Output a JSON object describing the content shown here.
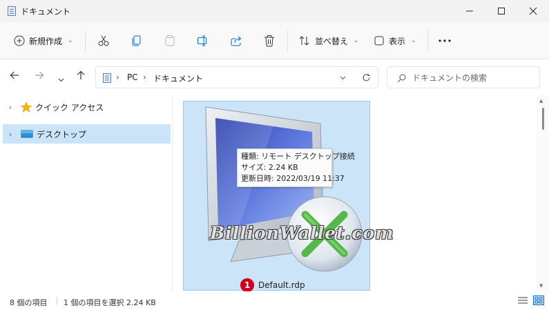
{
  "window": {
    "title": "ドキュメント",
    "minimize_icon": "minimize-icon",
    "maximize_icon": "maximize-icon",
    "close_icon": "close-icon"
  },
  "toolbar": {
    "new_label": "新規作成",
    "sort_label": "並べ替え",
    "view_label": "表示",
    "icons": [
      "cut-icon",
      "copy-icon",
      "paste-icon",
      "rename-icon",
      "share-icon",
      "delete-icon",
      "more-icon"
    ]
  },
  "address": {
    "breadcrumb": [
      "PC",
      "ドキュメント"
    ]
  },
  "search": {
    "placeholder": "ドキュメントの検索"
  },
  "nav": {
    "items": [
      {
        "label": "クイック アクセス",
        "icon": "star-icon"
      },
      {
        "label": "デスクトップ",
        "icon": "desktop-icon",
        "selected": true
      }
    ]
  },
  "file": {
    "name": "Default.rdp",
    "badge": "1",
    "tooltip": {
      "type": "種類: リモート デスクトップ接続",
      "size": "サイズ: 2.24 KB",
      "modified": "更新日時: 2022/03/19 11:37"
    }
  },
  "watermark": "BillionWallet.com",
  "status": {
    "count": "8 個の項目",
    "selected": "1 個の項目を選択  2.24 KB"
  },
  "colors": {
    "selection": "#cce4f7",
    "badge": "#d0021b",
    "accent": "#0067c0"
  }
}
